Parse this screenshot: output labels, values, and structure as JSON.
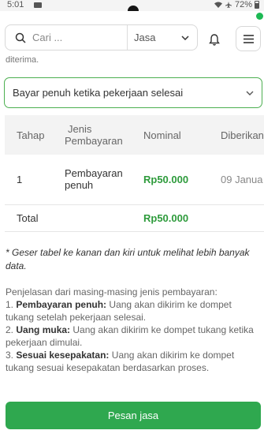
{
  "status_bar": {
    "time": "5:01",
    "battery": "72%"
  },
  "search": {
    "placeholder": "Cari ...",
    "category": "Jasa"
  },
  "content": {
    "cut_text": "diterima."
  },
  "payment_select": {
    "value": "Bayar penuh ketika pekerjaan selesai"
  },
  "table": {
    "headers": {
      "stage": "Tahap",
      "type_line1": "Jenis",
      "type_line2": "Pembayaran",
      "amount": "Nominal",
      "given": "Diberikan k"
    },
    "rows": [
      {
        "stage": "1",
        "type_line1": "Pembayaran",
        "type_line2": "penuh",
        "amount": "Rp50.000",
        "given": "09 Janua"
      }
    ],
    "total": {
      "label": "Total",
      "amount": "Rp50.000"
    }
  },
  "note": "* Geser tabel ke kanan dan kiri untuk melihat lebih banyak data.",
  "explanation": {
    "intro": "Penjelasan dari masing-masing jenis pembayaran:",
    "items": [
      {
        "num": "1.",
        "term": "Pembayaran penuh:",
        "desc": " Uang akan dikirim ke dompet tukang setelah pekerjaan selesai."
      },
      {
        "num": "2.",
        "term": "Uang muka:",
        "desc": " Uang akan dikirim ke dompet tukang ketika pekerjaan dimulai."
      },
      {
        "num": "3.",
        "term": "Sesuai kesepakatan:",
        "desc": " Uang akan dikirim ke dompet tukang sesuai kesepakatan berdasarkan proses."
      }
    ]
  },
  "order_button": {
    "label": "Pesan jasa"
  },
  "colors": {
    "accent": "#2fa84f",
    "nominal": "#2e9b3c",
    "select_border": "#4caf50"
  },
  "icons": [
    "search-icon",
    "chevron-down-icon",
    "bell-icon",
    "menu-icon",
    "wifi-icon",
    "airplane-icon",
    "battery-icon"
  ]
}
